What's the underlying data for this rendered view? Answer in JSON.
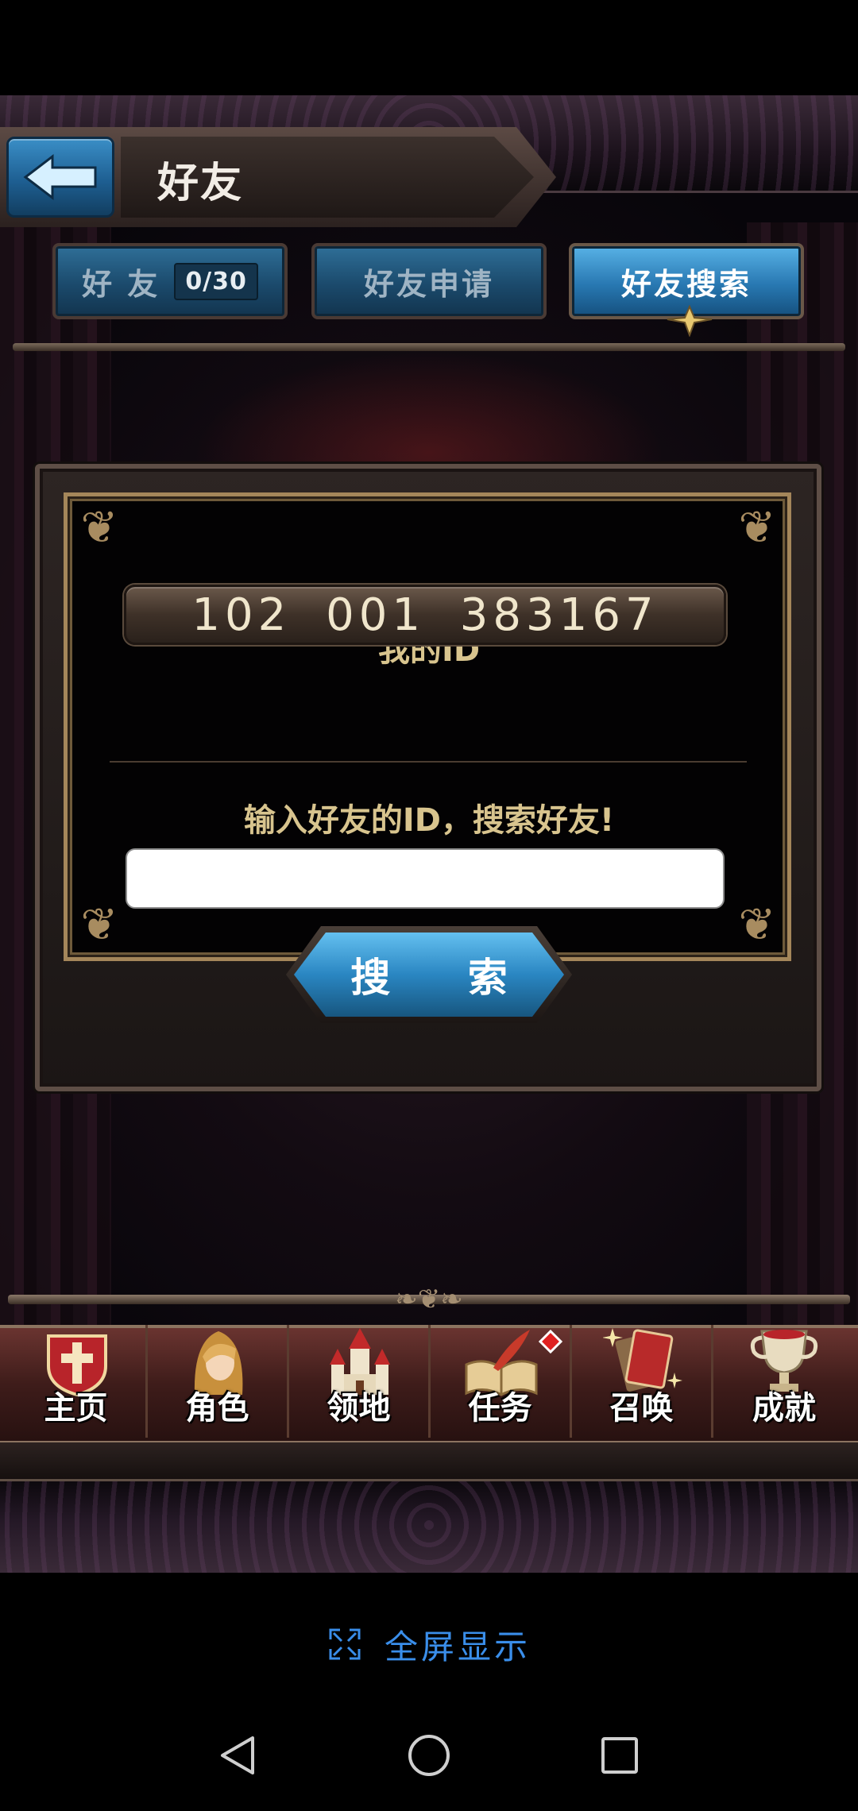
{
  "header": {
    "title": "好友"
  },
  "tabs": [
    {
      "label": "好 友",
      "count": "0/30",
      "active": false
    },
    {
      "label": "好友申请",
      "active": false
    },
    {
      "label": "好友搜索",
      "active": true
    }
  ],
  "panel": {
    "my_id_label": "我的ID",
    "my_id_value": "102 001 383167",
    "search_prompt": "输入好友的ID，搜索好友!",
    "search_input_value": "",
    "search_button": "搜 索"
  },
  "nav": [
    {
      "label": "主页",
      "icon": "home-shield-icon"
    },
    {
      "label": "角色",
      "icon": "character-icon"
    },
    {
      "label": "领地",
      "icon": "castle-icon"
    },
    {
      "label": "任务",
      "icon": "quest-book-icon",
      "badge": true
    },
    {
      "label": "召唤",
      "icon": "summon-cards-icon"
    },
    {
      "label": "成就",
      "icon": "trophy-icon"
    }
  ],
  "fullscreen_label": "全屏显示",
  "colors": {
    "accent_blue": "#3a8eea",
    "gold": "#d8c48e",
    "badge_red": "#e02020"
  }
}
